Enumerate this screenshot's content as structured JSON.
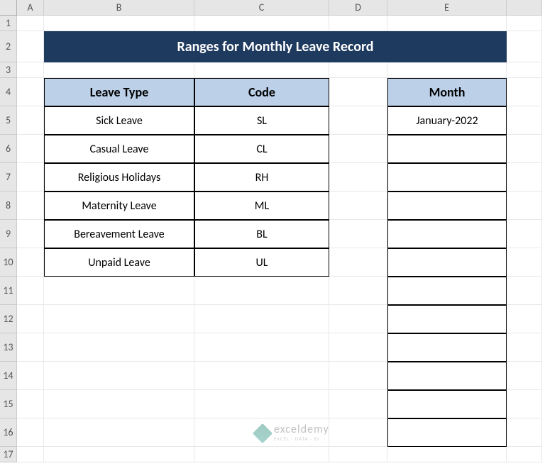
{
  "columns": [
    "A",
    "B",
    "C",
    "D",
    "E",
    ""
  ],
  "rows": [
    "1",
    "2",
    "3",
    "4",
    "5",
    "6",
    "7",
    "8",
    "9",
    "10",
    "11",
    "12",
    "13",
    "14",
    "15",
    "16",
    "17"
  ],
  "title": "Ranges for Monthly Leave Record",
  "leave_table": {
    "headers": {
      "type": "Leave Type",
      "code": "Code"
    },
    "rows": [
      {
        "type": "Sick Leave",
        "code": "SL"
      },
      {
        "type": "Casual Leave",
        "code": "CL"
      },
      {
        "type": "Religious Holidays",
        "code": "RH"
      },
      {
        "type": "Maternity Leave",
        "code": "ML"
      },
      {
        "type": "Bereavement Leave",
        "code": "BL"
      },
      {
        "type": "Unpaid Leave",
        "code": "UL"
      }
    ]
  },
  "month_table": {
    "header": "Month",
    "rows": [
      "January-2022",
      "",
      "",
      "",
      "",
      "",
      "",
      "",
      "",
      "",
      "",
      ""
    ]
  },
  "watermark": {
    "name": "exceldemy",
    "tag": "EXCEL · DATA · BI"
  }
}
